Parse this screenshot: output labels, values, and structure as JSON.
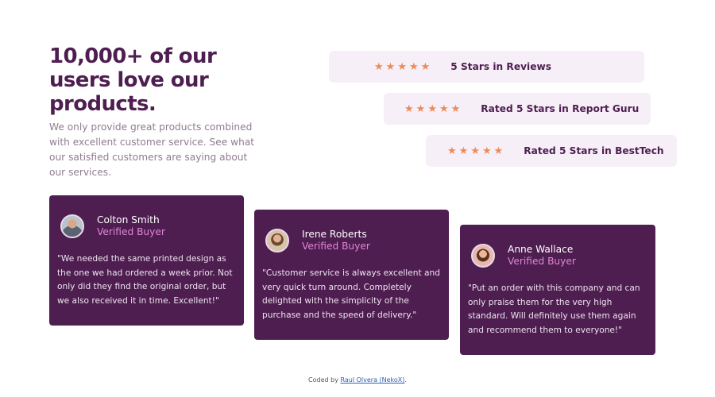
{
  "hero": {
    "title": "10,000+ of our users love our products.",
    "description": "We only provide great products combined with excellent customer service. See what our satisfied customers are saying about our services."
  },
  "ratings": [
    {
      "label": "5 Stars in Reviews",
      "stars": 5
    },
    {
      "label": "Rated 5 Stars in Report Guru",
      "stars": 5
    },
    {
      "label": "Rated 5 Stars in BestTech",
      "stars": 5
    }
  ],
  "testimonials": [
    {
      "name": "Colton Smith",
      "role": "Verified Buyer",
      "quote": "\"We needed the same printed design as the one we had ordered a week prior. Not only did they find the original order, but we also received it in time. Excellent!\""
    },
    {
      "name": "Irene Roberts",
      "role": "Verified Buyer",
      "quote": "\"Customer service is always excellent and very quick turn around. Completely delighted with the simplicity of the purchase and the speed of delivery.\""
    },
    {
      "name": "Anne Wallace",
      "role": "Verified Buyer",
      "quote": "\"Put an order with this company and can only praise them for the very high standard. Will definitely use them again and recommend them to everyone!\""
    }
  ],
  "footer": {
    "prefix": "Coded by",
    "author": "Raul Olvera (NekoX)",
    "suffix": "."
  },
  "icons": {
    "star": "star-icon",
    "avatar": "avatar-photo"
  },
  "colors": {
    "primary": "#4f1e51",
    "accent": "#ee8a55",
    "pink": "#e086d3",
    "rating_bg": "#f6eff7"
  }
}
